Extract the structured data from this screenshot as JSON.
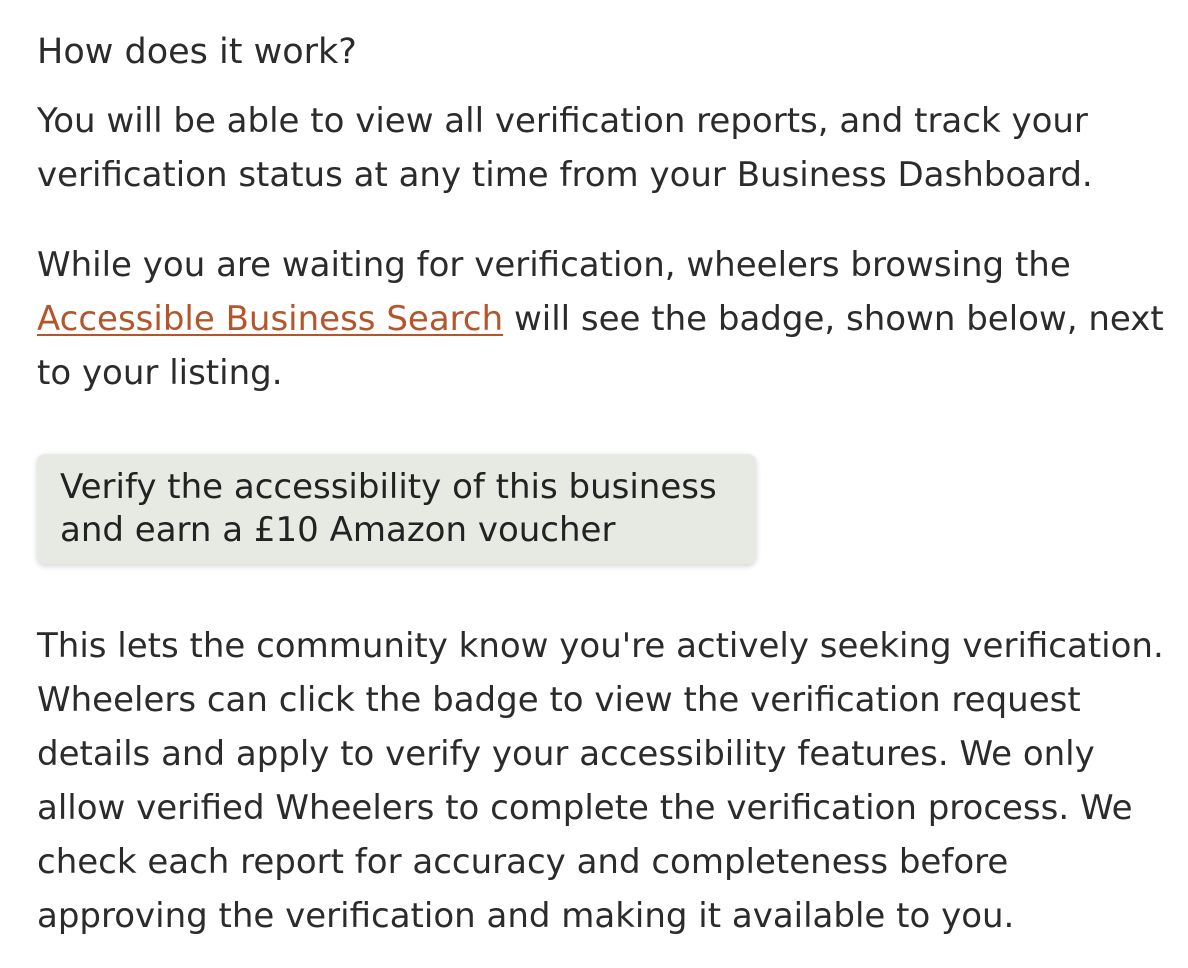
{
  "heading": "How does it work?",
  "para1": {
    "line1": "You will be able to view all verification reports, and track your",
    "line2": "verification status at any time from your Business Dashboard."
  },
  "para2": {
    "line1": "While you are waiting for verification, wheelers browsing the",
    "link_text": "Accessible Business Search",
    "line2_rest": " will see the badge, shown below, next",
    "line3": "to your listing."
  },
  "badge": {
    "line1": "Verify the accessibility of this business",
    "line2": "and earn a £10 Amazon voucher"
  },
  "para3": {
    "line1": "This lets the community know you're actively seeking verification.",
    "line2": "Wheelers can click the badge to view the verification request",
    "line3": "details and apply to verify your accessibility features. We only",
    "line4": "allow verified Wheelers to complete the verification process. We",
    "line5": "check each report for accuracy and completeness before",
    "line6": "approving the verification and making it available to you."
  },
  "colors": {
    "text": "#2b2b2b",
    "link": "#b5552b",
    "badge_bg": "#e7e9e3"
  }
}
